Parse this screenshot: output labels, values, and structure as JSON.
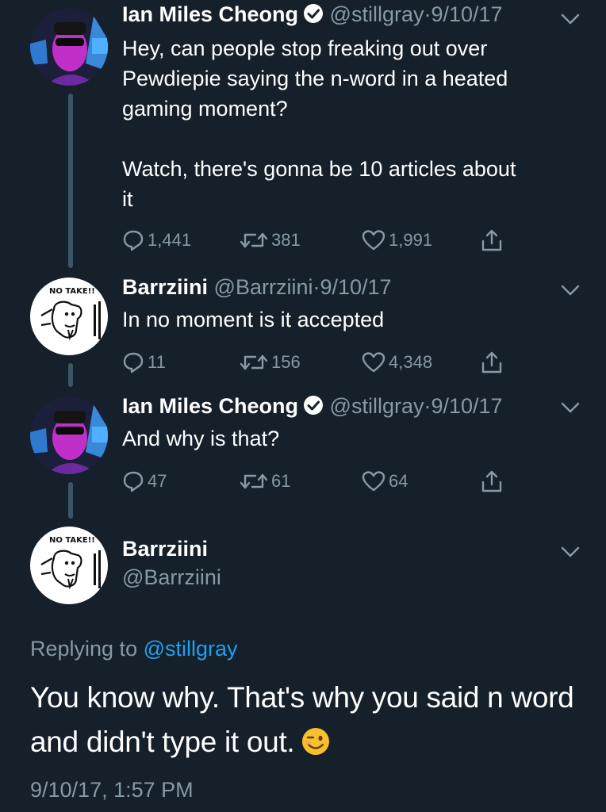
{
  "tweets": [
    {
      "name": "Ian Miles Cheong",
      "verified": true,
      "handle": "@stillgray",
      "separator": "·",
      "date": "9/10/17",
      "text": "Hey, can people stop freaking out over\nPewdiepie saying the n-word in a heated\ngaming moment?\n\nWatch, there's gonna be 10 articles about\nit",
      "replies": "1,441",
      "retweets": "381",
      "likes": "1,991"
    },
    {
      "name": "Barrziini",
      "verified": false,
      "handle": "@Barrziini",
      "separator": "·",
      "date": "9/10/17",
      "text": "In no moment is it accepted",
      "replies": "11",
      "retweets": "156",
      "likes": "4,348"
    },
    {
      "name": "Ian Miles Cheong",
      "verified": true,
      "handle": "@stillgray",
      "separator": "·",
      "date": "9/10/17",
      "text": "And why is that?",
      "replies": "47",
      "retweets": "61",
      "likes": "64"
    }
  ],
  "focused_tweet": {
    "name": "Barrziini",
    "handle": "@Barrziini",
    "replying_prefix": "Replying to",
    "replying_to": "@stillgray",
    "text": "You know why. That's why you said n word and didn't type it out.",
    "emoji": "winking-face",
    "timestamp": "9/10/17, 1:57 PM"
  },
  "avatar_labels": {
    "barrziini": "NO TAKE!!"
  },
  "colors": {
    "background": "#15202b",
    "secondary_text": "#8899a6",
    "link": "#1da1f2",
    "thread_line": "#3d5466"
  }
}
